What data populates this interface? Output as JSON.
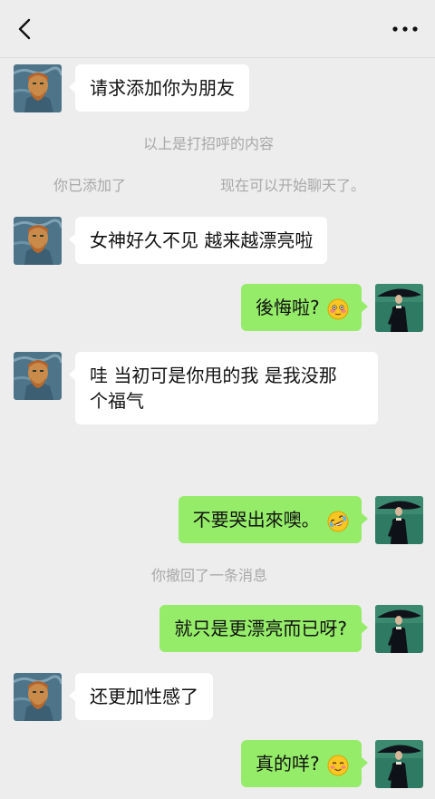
{
  "header": {
    "back_icon": "chevron-left-icon",
    "more_icon": "more-dots-icon"
  },
  "system": {
    "greeting_note": "以上是打招呼的内容",
    "added_left": "你已添加了",
    "added_right": "现在可以开始聊天了。",
    "recall_note": "你撤回了一条消息"
  },
  "messages": [
    {
      "side": "in",
      "text": "请求添加你为朋友"
    },
    {
      "side": "in",
      "text": "女神好久不见 越来越漂亮啦"
    },
    {
      "side": "out",
      "text": "後悔啦?",
      "emoji": "flushed-face-icon"
    },
    {
      "side": "in",
      "line1": "哇 当初可是你甩的我 是我没那",
      "line2": "个福气"
    },
    {
      "side": "out",
      "text": "不要哭出來噢。",
      "emoji": "rolling-laughing-face-icon"
    },
    {
      "side": "out",
      "text": "就只是更漂亮而已呀?"
    },
    {
      "side": "in",
      "text": "还更加性感了"
    },
    {
      "side": "out",
      "text": "真的咩?",
      "emoji": "smiling-face-icon"
    }
  ],
  "colors": {
    "background": "#ededed",
    "bubble_in": "#ffffff",
    "bubble_out": "#95ec69",
    "system_text": "#a8a8a8"
  }
}
